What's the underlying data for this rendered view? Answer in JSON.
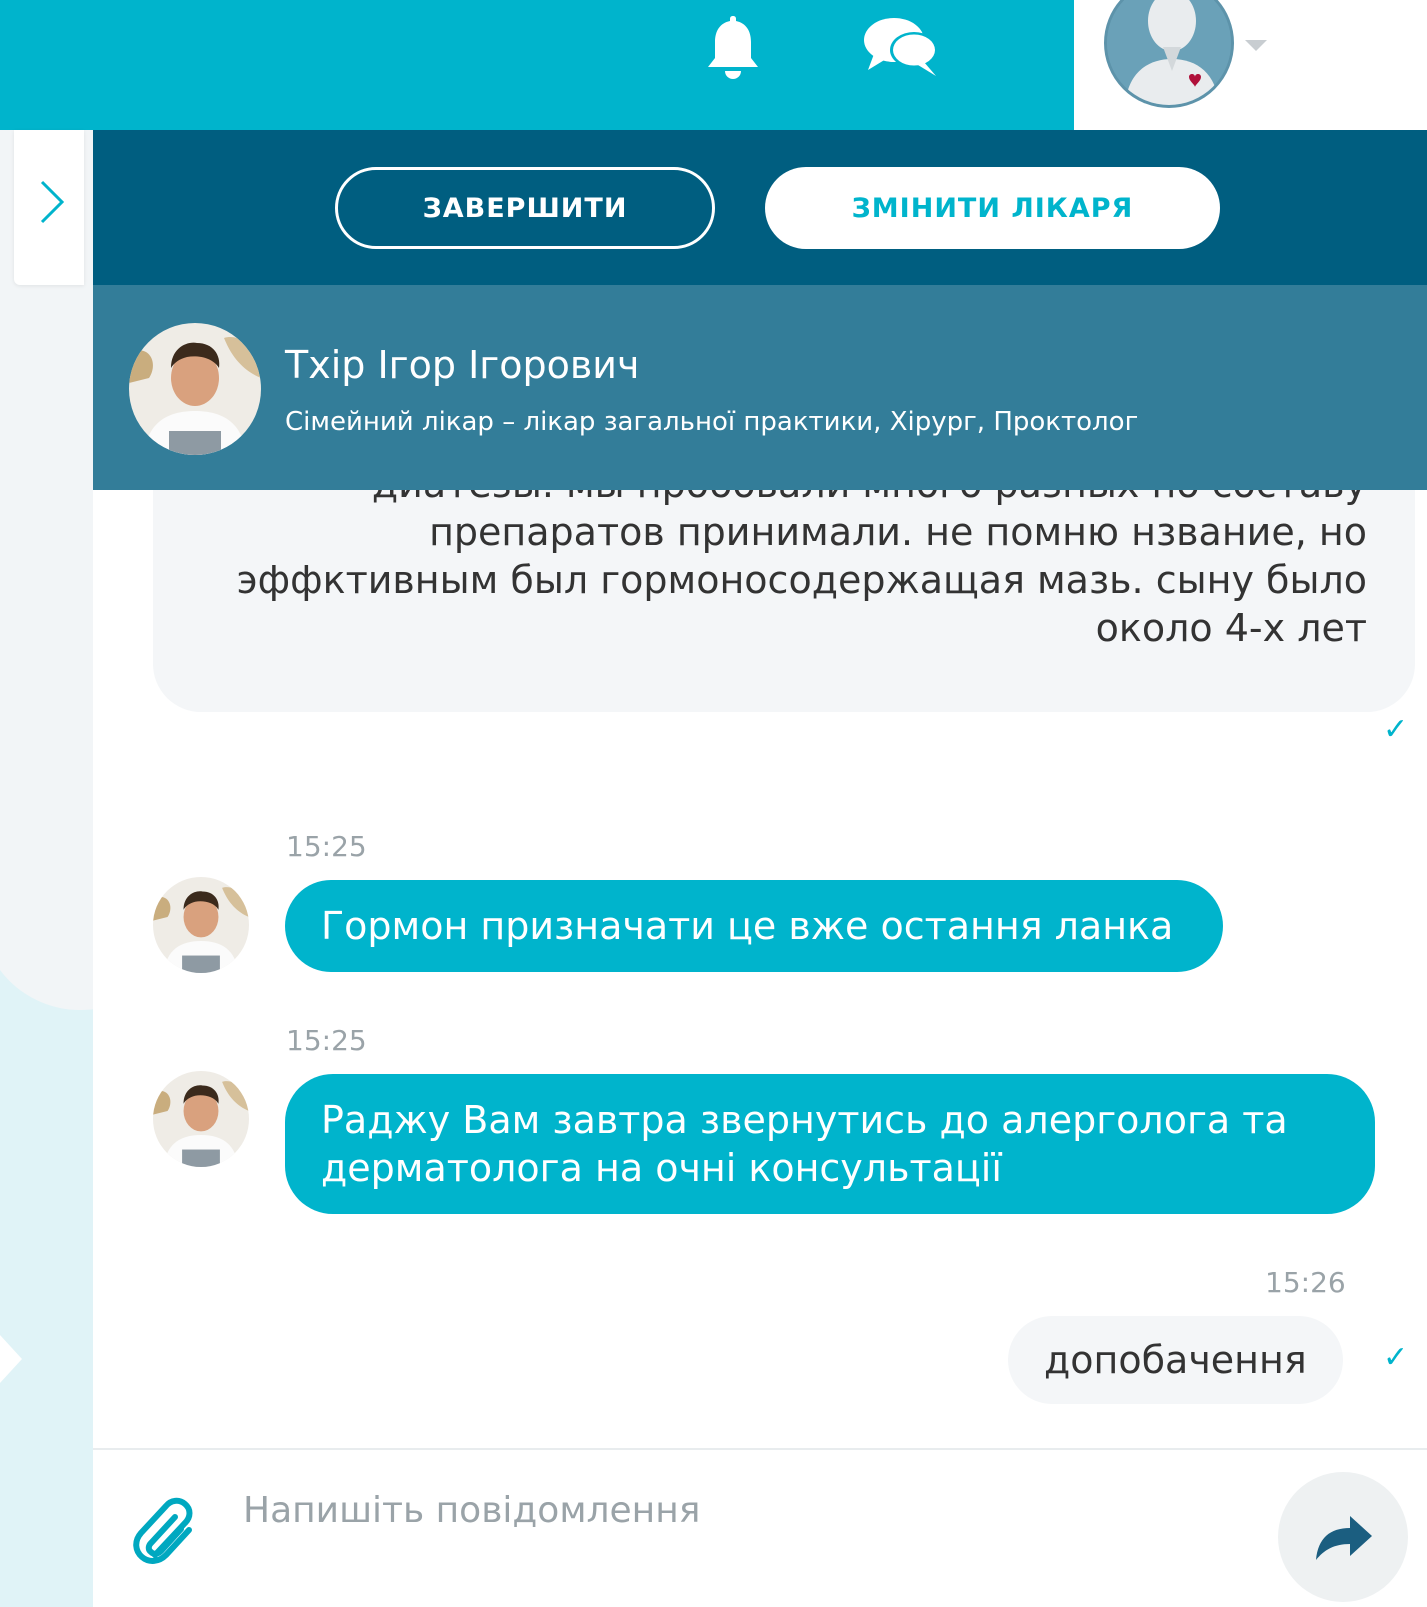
{
  "header": {
    "notifications_icon": "bell-icon",
    "messages_icon": "chat-bubbles-icon",
    "user_avatar_icon": "user-avatar-icon",
    "menu_caret_icon": "chevron-down-icon",
    "brand_color": "#00b4cc"
  },
  "sidebar": {
    "toggle_icon": "chevron-right-icon"
  },
  "actions": {
    "finish_label": "ЗАВЕРШИТИ",
    "change_doctor_label": "ЗМІНИТИ ЛІКАРЯ"
  },
  "doctor": {
    "name": "Тхір Ігор Ігорович",
    "specialization": "Сімейний лікар – лікар загальної практики, Хірург, Проктолог"
  },
  "messages": [
    {
      "sender": "user",
      "text": "у моего сташего сына в маленьком возрасте были частые диатезы. мы пробовали много разных по составу препаратов принимали. не помню нзвание, но эффктивным был гормоносодержащая мазь. сыну было около 4-х лет",
      "status": "read"
    },
    {
      "sender": "doctor",
      "time": "15:25",
      "text": "Гормон призначати це вже остання ланка"
    },
    {
      "sender": "doctor",
      "time": "15:25",
      "text": "Раджу Вам завтра звернутись до алерголога та дерматолога на очні консультації"
    },
    {
      "sender": "user",
      "time": "15:26",
      "text": "допобачення",
      "status": "read"
    }
  ],
  "composer": {
    "placeholder": "Напишіть повідомлення",
    "attach_icon": "paperclip-icon",
    "send_icon": "send-arrow-icon"
  },
  "check_mark": "✓"
}
